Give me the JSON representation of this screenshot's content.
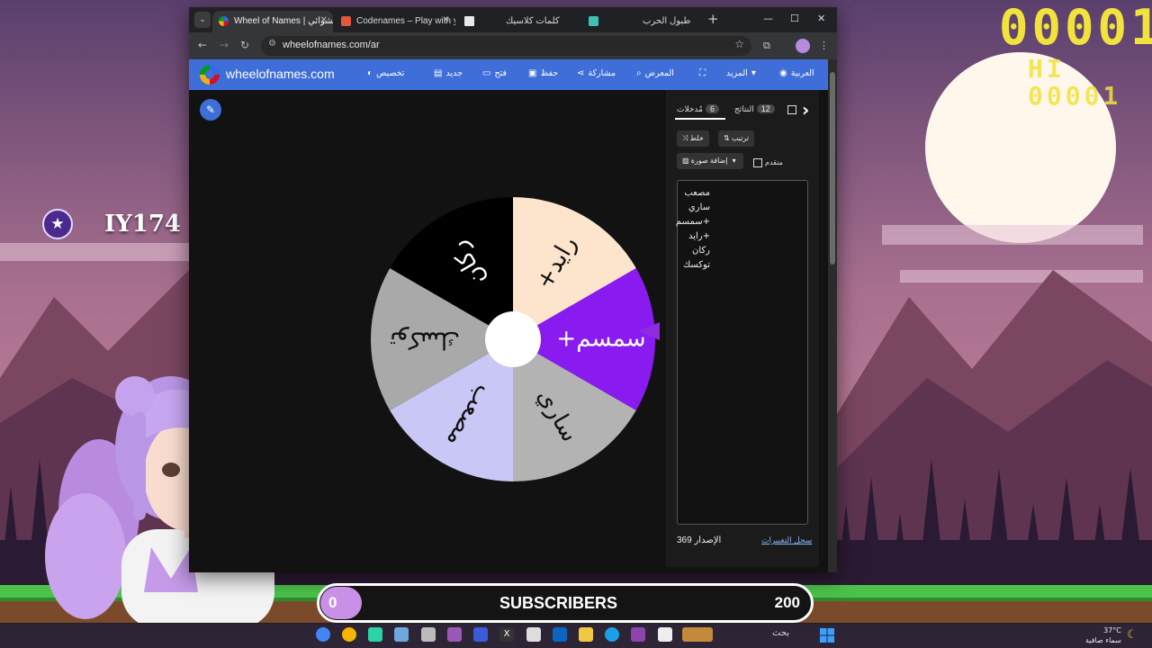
{
  "overlay": {
    "score": "00001",
    "hiscore": "HI 00001",
    "handle": "IY174",
    "badge_icon": "star-icon"
  },
  "browser": {
    "tabs": [
      {
        "title": "Wheel of Names | عجلة الأسماء العشوائي",
        "active": true
      },
      {
        "title": "Codenames – Play with your friends",
        "active": false
      },
      {
        "title": "كلمات كلاسيك",
        "active": false
      },
      {
        "title": "طبول الحرب",
        "active": false
      }
    ],
    "url": "wheelofnames.com/ar"
  },
  "site": {
    "name": "wheelofnames.com",
    "menu": [
      {
        "label": "تخصيص",
        "icon": "palette-icon"
      },
      {
        "label": "جديد",
        "icon": "file-icon"
      },
      {
        "label": "فتح",
        "icon": "folder-icon"
      },
      {
        "label": "حفظ",
        "icon": "save-icon"
      },
      {
        "label": "مشاركة",
        "icon": "share-icon"
      },
      {
        "label": "المعرض",
        "icon": "search-icon"
      },
      {
        "label": "",
        "icon": "fullscreen-icon"
      },
      {
        "label": "المزيد",
        "icon": "chevron-down-icon"
      },
      {
        "label": "العربية",
        "icon": "globe-icon"
      }
    ]
  },
  "wheel": {
    "segments": [
      {
        "label": "+رايد",
        "color": "#fde4cc"
      },
      {
        "label": "+سمسم",
        "color": "#8a1bf0"
      },
      {
        "label": "ساري",
        "color": "#b3b3b3"
      },
      {
        "label": "مصعب",
        "color": "#c9c7f5"
      },
      {
        "label": "توكسك",
        "color": "#a9a9a9"
      },
      {
        "label": "ركان",
        "color": "#000000"
      }
    ]
  },
  "panel": {
    "tab_entries": "مُدخلات",
    "tab_entries_count": "6",
    "tab_results": "النتائج",
    "tab_results_count": "12",
    "shuffle_label": "خلط",
    "sort_label": "ترتيب",
    "add_image_label": "إضافة صورة",
    "advanced_label": "متقدم",
    "entries": [
      "مصعب",
      "ساري",
      "+سمسم",
      "+رايد",
      "ركان",
      "توكسك"
    ],
    "version": "الإصدار 369",
    "changelog": "سجل التغييرات"
  },
  "subscribers": {
    "current": "0",
    "label": "SUBSCRIBERS",
    "goal": "200",
    "progress": 0
  },
  "taskbar": {
    "search": "بحث",
    "temp": "37°C",
    "weather": "سماء صافية"
  }
}
